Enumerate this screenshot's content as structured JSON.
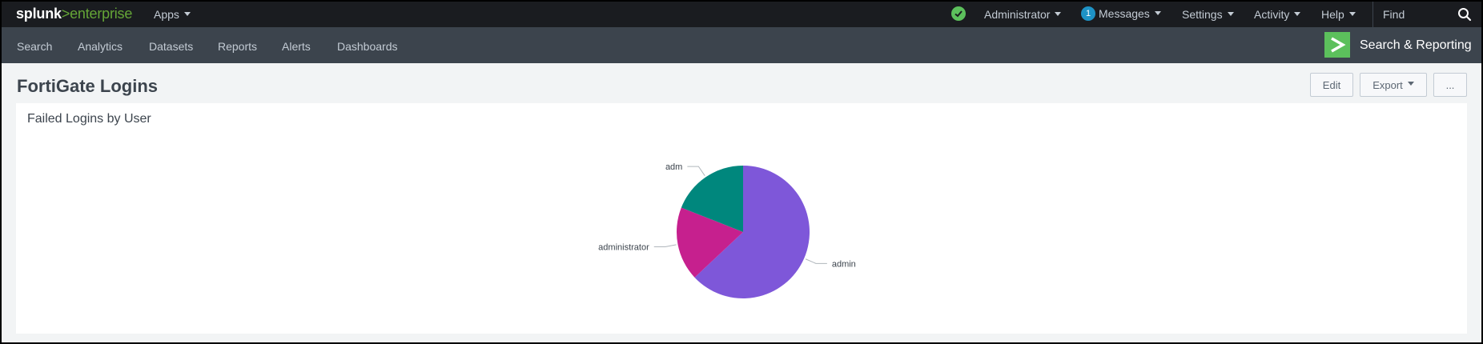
{
  "topbar": {
    "logo_splunk": "splunk",
    "logo_gt": ">",
    "logo_enterprise": "enterprise",
    "apps_label": "Apps",
    "status_icon": "check-circle-icon",
    "user_label": "Administrator",
    "messages_count": "1",
    "messages_label": "Messages",
    "settings_label": "Settings",
    "activity_label": "Activity",
    "help_label": "Help",
    "find_placeholder": "Find",
    "colors": {
      "bg": "#1a1c20",
      "logo_accent": "#65a637",
      "status_ok": "#5cc05c",
      "badge": "#1e93c6"
    }
  },
  "navbar": {
    "items": [
      "Search",
      "Analytics",
      "Datasets",
      "Reports",
      "Alerts",
      "Dashboards"
    ],
    "app_icon": "chevron-right-icon",
    "app_name": "Search & Reporting",
    "colors": {
      "bg": "#3c444d",
      "app_badge": "#5cc05c"
    }
  },
  "dashboard": {
    "title": "FortiGate Logins",
    "edit_label": "Edit",
    "export_label": "Export",
    "more_label": "..."
  },
  "panel": {
    "title": "Failed Logins by User"
  },
  "chart_data": {
    "type": "pie",
    "title": "",
    "categories": [
      "admin",
      "administrator",
      "adm"
    ],
    "values": [
      63,
      18,
      19
    ],
    "colors": [
      "#7e57d9",
      "#c6208e",
      "#00877d"
    ],
    "legend": "none (labels with leader lines)"
  }
}
